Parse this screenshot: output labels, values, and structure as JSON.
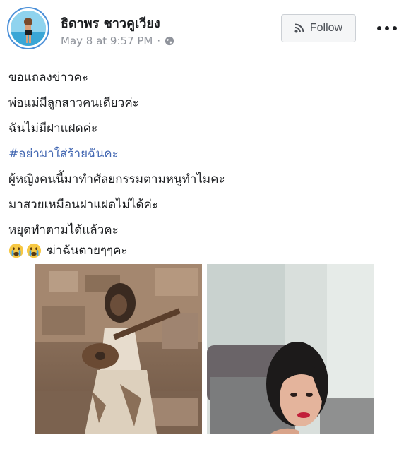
{
  "post": {
    "author": "ธิดาพร ชาวคูเวียง",
    "date": "May 8 at 9:57 PM",
    "separator": "·",
    "privacy_icon": "globe-icon",
    "follow_label": "Follow",
    "more_icon": "more-options-icon",
    "lines": [
      "ขอแถลงข่าวคะ",
      "พ่อแม่มีลูกสาวคนเดียวค่ะ",
      "ฉันไม่มีฝาแฝดค่ะ",
      "#อย่ามาใส่ร้ายฉันคะ",
      "ผู้หญิงคนนี้มาทำศัลยกรรมตามหนูทำไมคะ",
      "มาสวยเหมือนฝาแฝดไม่ได้ค่ะ",
      "หยุดทำตามได้แล้วคะ"
    ],
    "last_line": "ฆ่าฉันตายๆๆคะ",
    "emoji_icon": "crying-face-emoji",
    "colors": {
      "hashtag": "#4267b2",
      "meta": "#90949c",
      "avatar_ring": "#4a8fd8"
    },
    "photos": [
      {
        "name": "sepia-photo-woman-with-guitar"
      },
      {
        "name": "photo-woman-in-bedroom"
      }
    ]
  }
}
